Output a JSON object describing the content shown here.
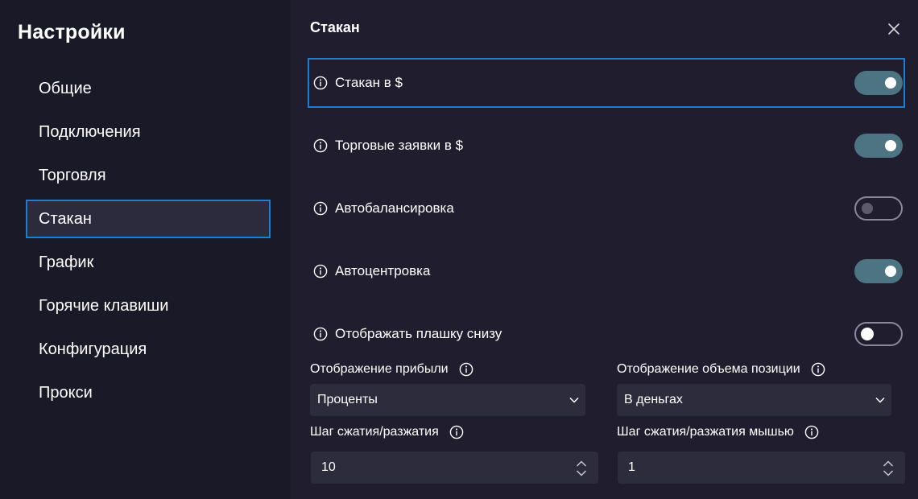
{
  "sidebar": {
    "title": "Настройки",
    "items": [
      {
        "label": "Общие"
      },
      {
        "label": "Подключения"
      },
      {
        "label": "Торговля"
      },
      {
        "label": "Стакан",
        "active": true
      },
      {
        "label": "График"
      },
      {
        "label": "Горячие клавиши"
      },
      {
        "label": "Конфигурация"
      },
      {
        "label": "Прокси"
      }
    ]
  },
  "panel": {
    "title": "Стакан",
    "close_icon": "close-icon",
    "toggles": [
      {
        "label": "Стакан в $",
        "enabled": true
      },
      {
        "label": "Торговые заявки в $",
        "enabled": true
      },
      {
        "label": "Автобалансировка",
        "enabled": false
      },
      {
        "label": "Автоцентровка",
        "enabled": true
      },
      {
        "label": "Отображать плашку снизу",
        "enabled": false
      }
    ],
    "profit_display": {
      "label": "Отображение прибыли",
      "value": "Проценты"
    },
    "position_volume_display": {
      "label": "Отображение объема позиции",
      "value": "В деньгах"
    },
    "zoom_step": {
      "label": "Шаг сжатия/разжатия",
      "value": "10"
    },
    "mouse_zoom_step": {
      "label": "Шаг сжатия/разжатия мышью",
      "value": "1"
    }
  },
  "colors": {
    "background": "#201e2e",
    "sidebar_background": "#1a1927",
    "accent_focus": "#1a7fd0",
    "toggle_on": "#4d7483",
    "field_background": "#2d2c3d"
  }
}
